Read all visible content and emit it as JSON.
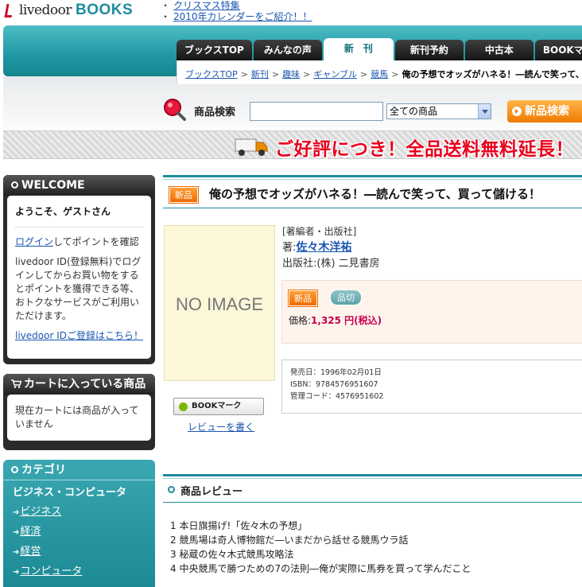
{
  "header": {
    "logo_name": "livedoor",
    "logo_books": "BOOKS",
    "promo_links": [
      "クリスマス特集",
      "2010年カレンダーをご紹介！！"
    ],
    "promo_bullet": "・"
  },
  "tabs": [
    {
      "label": "ブックスTOP",
      "active": false
    },
    {
      "label": "みんなの声",
      "active": false
    },
    {
      "label": "新　刊",
      "active": true
    },
    {
      "label": "新刊予約",
      "active": false
    },
    {
      "label": "中古本",
      "active": false
    },
    {
      "label": "BOOKマーク",
      "active": false
    }
  ],
  "breadcrumb": {
    "items": [
      "ブックスTOP",
      "新刊",
      "趣味",
      "ギャンブル",
      "競馬"
    ],
    "separator": ">",
    "current": "俺の予想でオッズがハネる！―読んで笑って、買って儲ける！"
  },
  "search": {
    "label": "商品検索",
    "input_value": "",
    "category_selected": "全ての商品",
    "button_label": "新品検索"
  },
  "banner": {
    "text": "ご好評につき！全品送料無料延長！"
  },
  "welcome": {
    "title": "WELCOME",
    "greeting": "ようこそ、ゲストさん",
    "login_link": "ログイン",
    "login_suffix": "してポイントを確認",
    "description": "livedoor ID(登録無料)でログインしてからお買い物をするとポイントを獲得できる等、おトクなサービスがご利用いただけます。",
    "register_link": "livedoor IDご登録はこちら！"
  },
  "cart": {
    "title": "カートに入っている商品",
    "message": "現在カートには商品が入っていません"
  },
  "category": {
    "title": "カテゴリ",
    "heading": "ビジネス・コンピュータ",
    "items": [
      "ビジネス",
      "経済",
      "経営",
      "コンピュータ"
    ]
  },
  "product": {
    "badge": "新品",
    "title": "俺の予想でオッズがハネる！―読んで笑って、買って儲ける！",
    "cover_text": "NO IMAGE",
    "bookmark_label": "BOOKマーク",
    "review_link": "レビューを書く",
    "info_head": "[著編者・出版社]",
    "author_prefix": "著:",
    "author": "佐々木洋祐",
    "publisher": "出版社:(株) 二見書房",
    "price_badge": "新品",
    "stock_badge": "品切",
    "price_label": "価格:",
    "price": "1,325 円(税込)",
    "release_date": "発売日：1996年02月01日",
    "isbn": "ISBN：9784576951607",
    "code": "管理コード：4576951602"
  },
  "reviews": {
    "title": "商品レビュー",
    "items": [
      "1 本日旗揚げ!「佐々木の予想」",
      "2 競馬場は奇人博物館だ―いまだから話せる競馬ウラ話",
      "3 秘蔵の佐々木式競馬攻略法",
      "4 中央競馬で勝つための7の法則―俺が実際に馬券を買って学んだこと"
    ]
  },
  "colors": {
    "teal": "#1e8c9e",
    "orange": "#ef7a00",
    "price": "#c40050",
    "banner_red": "#e8001c"
  }
}
